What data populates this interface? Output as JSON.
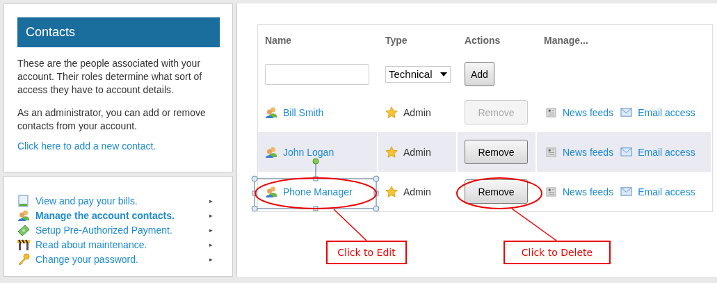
{
  "contacts_panel": {
    "title": "Contacts",
    "paragraphs": [
      "These are the people associated with your account. Their roles determine what sort of access they have to account details.",
      "As an administrator, you can add or remove contacts from your account."
    ],
    "add_link": "Click here to add a new contact."
  },
  "nav_menu": [
    {
      "label": "View and pay your bills.",
      "selected": false,
      "arrow": "▸"
    },
    {
      "label": "Manage the account contacts.",
      "selected": true,
      "arrow": "▸"
    },
    {
      "label": "Setup Pre-Authorized Payment.",
      "selected": false,
      "arrow": "▸"
    },
    {
      "label": "Read about maintenance.",
      "selected": false,
      "arrow": "▸"
    },
    {
      "label": "Change your password.",
      "selected": false,
      "arrow": "▸"
    }
  ],
  "table": {
    "columns": [
      "Name",
      "Type",
      "Actions",
      "Manage..."
    ],
    "new_row": {
      "type_select": "Technical",
      "add_button": "Add"
    },
    "rows": [
      {
        "name": "Bill Smith",
        "type": "Admin",
        "remove_button": "Remove",
        "disabled": true,
        "selected": false,
        "links": [
          "News feeds",
          "Email access"
        ]
      },
      {
        "name": "John Logan",
        "type": "Admin",
        "remove_button": "Remove",
        "disabled": false,
        "selected": true,
        "links": [
          "News feeds",
          "Email access"
        ]
      },
      {
        "name": "Phone Manager",
        "type": "Admin",
        "remove_button": "Remove",
        "disabled": false,
        "selected": false,
        "links": [
          "News feeds",
          "Email access"
        ]
      }
    ]
  },
  "annotations": [
    {
      "text": "Click to Edit"
    },
    {
      "text": "Click to Delete"
    }
  ]
}
